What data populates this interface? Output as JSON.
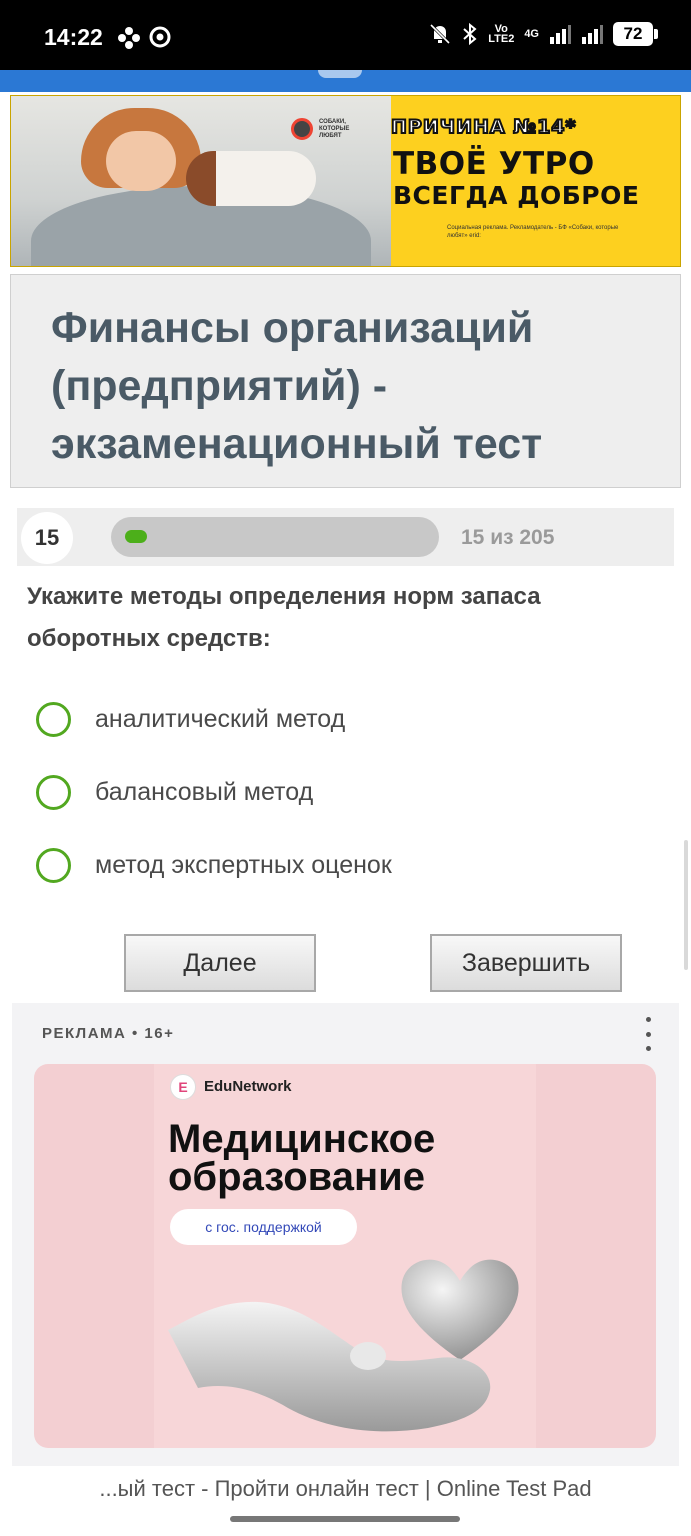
{
  "status_bar": {
    "time": "14:22",
    "network_label": "4G",
    "lte_label_top": "Vo",
    "lte_label_bottom": "LTE2",
    "battery": "72"
  },
  "top_banner": {
    "brand": "СОБАКИ, КОТОРЫЕ ЛЮБЯТ",
    "reason": "ПРИЧИНА №14*",
    "headline_line1": "ТВОЁ УТРО",
    "headline_line2": "ВСЕГДА ДОБРОЕ",
    "small_text": "Социальная реклама. Рекламодатель - БФ «Собаки, которые любят» erid:"
  },
  "page": {
    "title": "Финансы организаций (предприятий) - экзаменационный тест"
  },
  "progress": {
    "question_number": "15",
    "progress_text": "15 из 205",
    "fraction": 0.073
  },
  "question": {
    "text": "Укажите методы определения норм запаса оборотных средств:",
    "options": [
      {
        "label": "аналитический метод"
      },
      {
        "label": "балансовый метод"
      },
      {
        "label": "метод экспертных оценок"
      }
    ]
  },
  "buttons": {
    "next_label": "Далее",
    "finish_label": "Завершить"
  },
  "ad": {
    "label": "РЕКЛАМА • 16+",
    "brand": "EduNetwork",
    "brand_letter": "E",
    "headline_line1": "Медицинское",
    "headline_line2": "образование",
    "pill": "с гос. поддержкой"
  },
  "url_bar": {
    "text": "...ый тест - Пройти онлайн тест | Online Test Pad"
  },
  "colors": {
    "accent_green": "#52a820",
    "progress_green": "#4caf1a",
    "banner_yellow": "#fdd01f",
    "browser_blue": "#2b78d4",
    "title_color": "#4a5a66",
    "ad_pink": "#f3cfd2"
  }
}
